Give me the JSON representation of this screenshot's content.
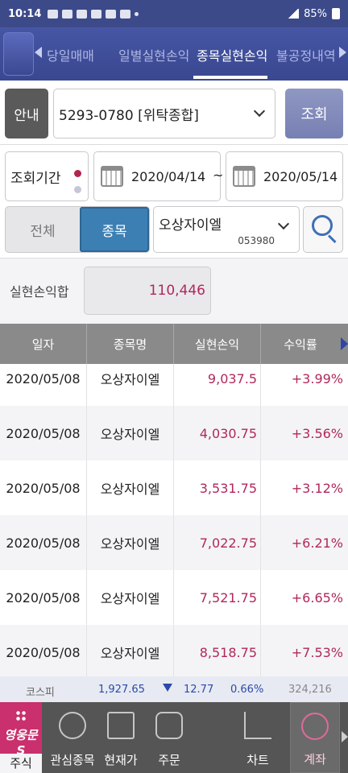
{
  "status_bar": {
    "time": "10:14",
    "battery": "85%"
  },
  "tabs": [
    {
      "label": "당일매매",
      "active": false
    },
    {
      "label": "일별실현손익",
      "active": false
    },
    {
      "label": "종목실현손익",
      "active": true
    },
    {
      "label": "불공정내역",
      "active": false
    }
  ],
  "account": {
    "guide_label": "안내",
    "account_value": "5293-0780 [위탁종합]",
    "query_label": "조회"
  },
  "period": {
    "label": "조회기간",
    "start_date": "2020/04/14",
    "separator": "~",
    "end_date": "2020/05/14"
  },
  "filter": {
    "options": [
      "전체",
      "종목"
    ],
    "selected": "종목",
    "stock_name": "오상자이엘",
    "stock_code": "053980"
  },
  "summary": {
    "label": "실현손익합",
    "value": "110,446"
  },
  "table": {
    "headers": [
      "일자",
      "종목명",
      "실현손익",
      "수익률"
    ],
    "rows": [
      [
        "2020/05/08",
        "오상자이엘",
        "9,037.5",
        "+3.99%"
      ],
      [
        "2020/05/08",
        "오상자이엘",
        "4,030.75",
        "+3.56%"
      ],
      [
        "2020/05/08",
        "오상자이엘",
        "3,531.75",
        "+3.12%"
      ],
      [
        "2020/05/08",
        "오상자이엘",
        "7,022.75",
        "+6.21%"
      ],
      [
        "2020/05/08",
        "오상자이엘",
        "7,521.75",
        "+6.65%"
      ],
      [
        "2020/05/08",
        "오상자이엘",
        "8,518.75",
        "+7.53%"
      ]
    ]
  },
  "market": {
    "index_name": "코스피",
    "value": "1,927.65",
    "change": "12.77",
    "change_pct": "0.66%",
    "volume": "324,216"
  },
  "bottom_nav": {
    "brand": "영웅문S",
    "items": [
      "주식",
      "관심종목",
      "현재가",
      "주문",
      "차트",
      "계좌"
    ],
    "active": "계좌"
  },
  "colors": {
    "header": "#3c4a8a",
    "accent_pink": "#b0285a",
    "segment_active": "#3c7fb3",
    "brand_magenta": "#c9306d"
  }
}
